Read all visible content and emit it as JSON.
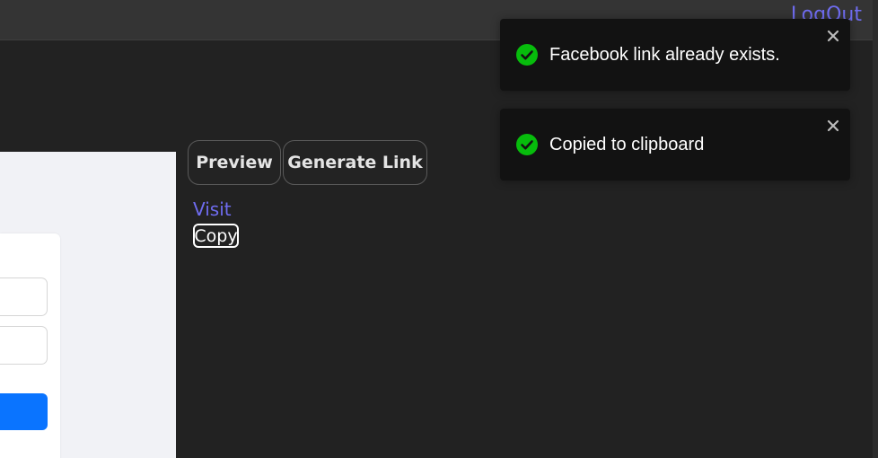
{
  "header": {
    "logout_label": "LogOut"
  },
  "tabs": {
    "preview_label": "Preview",
    "generate_label": "Generate Link"
  },
  "link_actions": {
    "visit_label": "Visit",
    "copy_label": "Copy"
  },
  "toasts": [
    {
      "message": "Facebook link already exists.",
      "icon": "check-circle-icon",
      "type": "success"
    },
    {
      "message": "Copied to clipboard",
      "icon": "check-circle-icon",
      "type": "success"
    }
  ],
  "colors": {
    "background": "#222222",
    "topbar": "#343434",
    "accent_link": "#6f6cf0",
    "toast_bg": "#121212",
    "success_green": "#07bc0c",
    "submit_blue": "#0a74ff"
  }
}
